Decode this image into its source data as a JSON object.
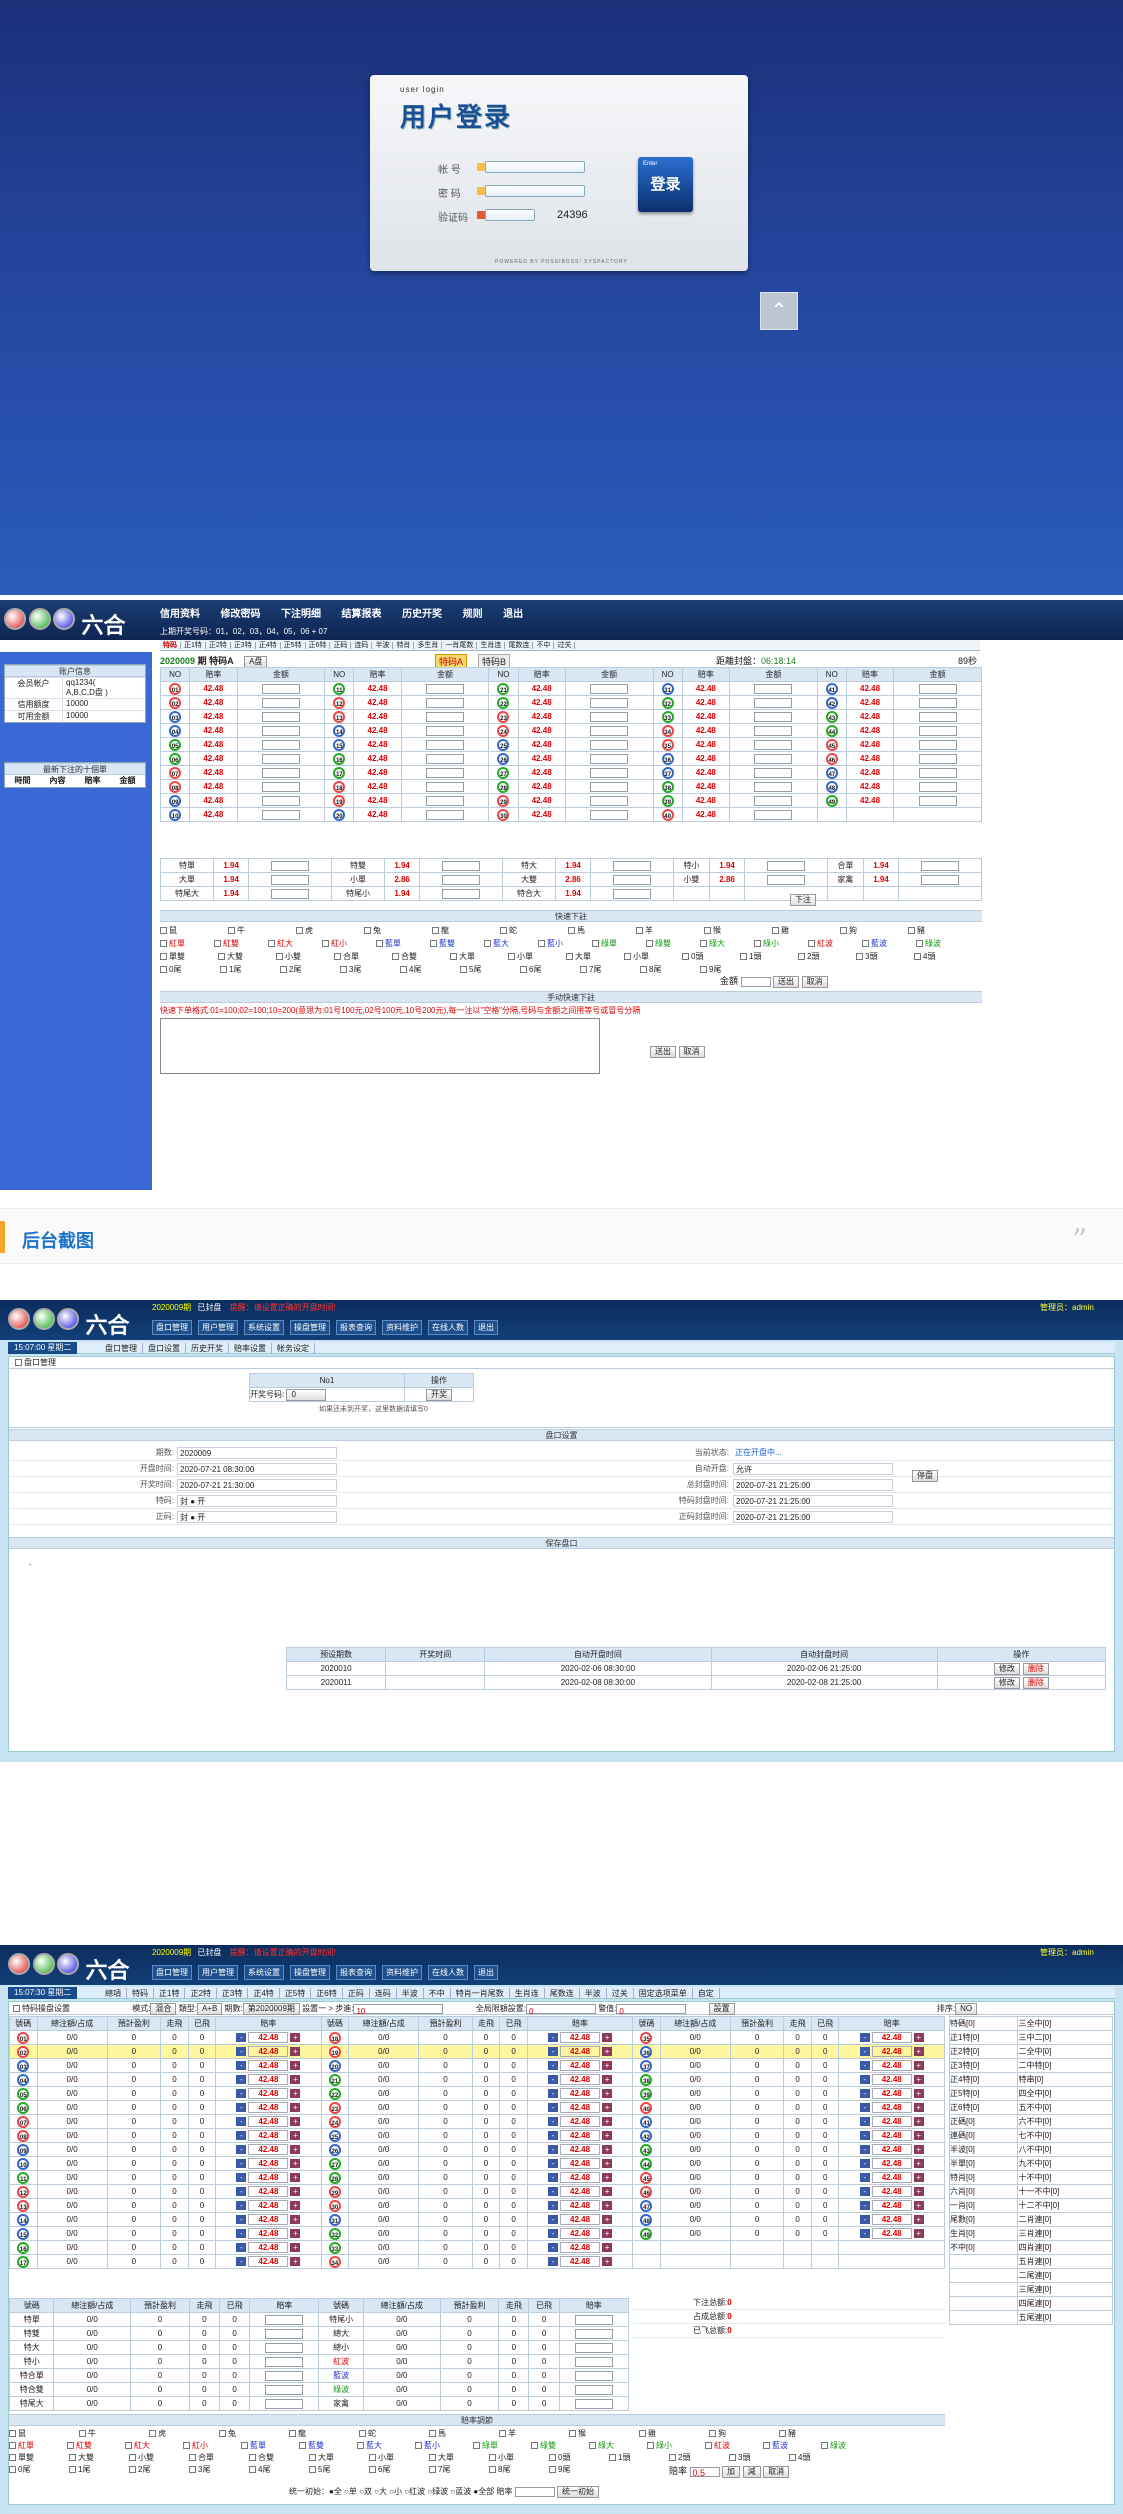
{
  "login": {
    "subtitle": "user login",
    "title": "用户登录",
    "fields": [
      {
        "label": "帐  号"
      },
      {
        "label": "密  码"
      },
      {
        "label": "验证码",
        "code": "24396"
      }
    ],
    "button_small": "Enter",
    "button_label": "登录",
    "powered": "POWERED BY POSSIBOSS! SYSPACTORY",
    "scroll_icon": "chevron-up-icon"
  },
  "member": {
    "nav": [
      "信用资料",
      "修改密码",
      "下注明细",
      "结算报表",
      "历史开奖",
      "规则",
      "退出"
    ],
    "draw_result_label": "上期开奖号码：",
    "draw_result": "01，02，03，04，05，06 + 07",
    "tabs": [
      "特码",
      "正1特",
      "正2特",
      "正3特",
      "正4特",
      "正5特",
      "正6特",
      "正码",
      "连码",
      "半波",
      "特肖",
      "多生肖",
      "一肖尾数",
      "生肖连",
      "尾数连",
      "不中",
      "过关"
    ],
    "account_title": "账户信息",
    "account_rows": [
      {
        "k": "会员帐户",
        "v": "qq1234(\nA,B,C,D盘 )"
      },
      {
        "k": "信用额度",
        "v": "10000"
      },
      {
        "k": "可用金额",
        "v": "10000"
      }
    ],
    "recent_title": "最新下注的十個單",
    "recent_cols": [
      "時間",
      "內容",
      "賠率",
      "金額"
    ],
    "issue": "2020009",
    "issue_label": "期 特码A",
    "pan": "A盘",
    "tab_a": "特码A",
    "tab_b": "特码B",
    "close_label": "距離封盤：",
    "close_time": "06:18:14",
    "countdown": "89秒",
    "col_no": "NO",
    "col_odds": "赔率",
    "col_amount": "金额",
    "odds": "42.48",
    "balls": [
      [
        "01",
        "02",
        "03",
        "04",
        "05",
        "06",
        "07",
        "08",
        "09",
        "10"
      ],
      [
        "11",
        "12",
        "13",
        "14",
        "15",
        "16",
        "17",
        "18",
        "19",
        "20"
      ],
      [
        "21",
        "22",
        "23",
        "24",
        "25",
        "26",
        "27",
        "28",
        "29",
        "30"
      ],
      [
        "31",
        "32",
        "33",
        "34",
        "35",
        "36",
        "37",
        "38",
        "39",
        "40"
      ],
      [
        "41",
        "42",
        "43",
        "44",
        "45",
        "46",
        "47",
        "48",
        "49"
      ]
    ],
    "bottom_rows": [
      [
        {
          "k": "特單",
          "v": "1.94"
        },
        {
          "k": "特雙",
          "v": "1.94"
        },
        {
          "k": "特大",
          "v": "1.94"
        },
        {
          "k": "特小",
          "v": "1.94"
        },
        {
          "k": "合單",
          "v": "1.94"
        }
      ],
      [
        {
          "k": "大單",
          "v": "1.94"
        },
        {
          "k": "小單",
          "v": "2.86"
        },
        {
          "k": "大雙",
          "v": "2.86"
        },
        {
          "k": "小雙",
          "v": "2.86"
        },
        {
          "k": "家禽",
          "v": "1.94"
        }
      ],
      [
        {
          "k": "特尾大",
          "v": "1.94"
        },
        {
          "k": "特尾小",
          "v": "1.94"
        },
        {
          "k": "特合大",
          "v": "1.94"
        }
      ]
    ],
    "next_btn": "下注",
    "quick_title": "快速下註",
    "quick_zodiac": [
      "鼠",
      "牛",
      "虎",
      "兔",
      "龍",
      "蛇",
      "馬",
      "羊",
      "猴",
      "雞",
      "狗",
      "豬"
    ],
    "quick_colors": [
      "紅單",
      "紅雙",
      "紅大",
      "紅小",
      "藍單",
      "藍雙",
      "藍大",
      "藍小",
      "綠單",
      "綠雙",
      "綠大",
      "綠小",
      "紅波",
      "藍波",
      "綠波"
    ],
    "quick_size": [
      "單雙",
      "大雙",
      "小雙",
      "合單",
      "合雙",
      "大單",
      "小單",
      "大單",
      "小單",
      "0頭",
      "1頭",
      "2頭",
      "3頭",
      "4頭"
    ],
    "quick_tail": [
      "0尾",
      "1尾",
      "2尾",
      "3尾",
      "4尾",
      "5尾",
      "6尾",
      "7尾",
      "8尾",
      "9尾"
    ],
    "quick_amount_label": "金額",
    "quick_submit": "送出",
    "quick_cancel": "取消",
    "manual_title": "手动快速下註",
    "manual_hint": "快速下单格式:01=100;02=100;10=200(意思为:01号100元,02号100元,10号200元),每一注以\"空格\"分隔,号码与金额之间用等号或冒号分隔",
    "manual_submit": "送出",
    "manual_cancel": "取消"
  },
  "section_heading": "后台截图",
  "quote_icon": "quote-icon",
  "admin1": {
    "issue_tag": "2020009期",
    "status": "已封盘",
    "notice": "提醒：请设置正确的开盘时间!",
    "admin_label": "管理员：admin",
    "menu": [
      "盘口管理",
      "用户管理",
      "系统设置",
      "操盘管理",
      "报表查询",
      "资料维护",
      "在线人数",
      "退出"
    ],
    "clock": "15:07:00 星期二",
    "tabs": [
      "盘口管理",
      "盘口设置",
      "历史开奖",
      "赔率设置",
      "帐务设定"
    ],
    "section_title": "盘口管理",
    "open_table_header": [
      "No1",
      "操作"
    ],
    "open_number_label": "开奖号码:",
    "open_number_value": "0",
    "open_btn": "开奖",
    "open_hint": "如果还未到开奖，这里数据请填写0",
    "settings_title": "盘口设置",
    "form_left": [
      {
        "k": "期数:",
        "v": "2020009"
      },
      {
        "k": "开盘时间:",
        "v": "2020-07-21 08:30:00"
      },
      {
        "k": "开奖时间:",
        "v": "2020-07-21 21:30:00"
      },
      {
        "k": "特码:",
        "v": "封  ● 开"
      },
      {
        "k": "正码:",
        "v": "封  ● 开"
      }
    ],
    "form_right": [
      {
        "k": "当前状态:",
        "v": "正在开盘中..."
      },
      {
        "k": "自动开盘:",
        "v": "允许"
      },
      {
        "k": "总封盘时间:",
        "v": "2020-07-21 21:25:00"
      },
      {
        "k": "特码封盘时间:",
        "v": "2020-07-21 21:25:00"
      },
      {
        "k": "正码封盘时间:",
        "v": "2020-07-21 21:25:00"
      }
    ],
    "stop_btn": "停盘",
    "save_btn": "保存盘口",
    "schedule_cols": [
      "预设期数",
      "开奖时间",
      "自动开盘时间",
      "自动封盘时间",
      "操作"
    ],
    "schedule_rows": [
      {
        "id": "2020010",
        "open": "2020-02-06 08:30:00",
        "close": "2020-02-06 21:25:00"
      },
      {
        "id": "2020011",
        "open": "2020-02-08 08:30:00",
        "close": "2020-02-08 21:25:00"
      }
    ],
    "edit_btn": "修改",
    "delete_btn": "删除"
  },
  "admin2": {
    "issue_tag": "2020009期",
    "status": "已封盘",
    "notice": "提醒：请设置正确的开盘时间!",
    "admin_label": "管理员：admin",
    "menu": [
      "盘口管理",
      "用户管理",
      "系统设置",
      "操盘管理",
      "报表查询",
      "资料维护",
      "在线人数",
      "退出"
    ],
    "clock": "15:07:30 星期二",
    "tabs": [
      "總項",
      "特码",
      "正1特",
      "正2特",
      "正3特",
      "正4特",
      "正5特",
      "正6特",
      "正码",
      "连码",
      "半波",
      "不中",
      "特肖一肖尾数",
      "生肖连",
      "尾数连",
      "半波",
      "过关",
      "固定选项菜单",
      "自定"
    ],
    "filter": {
      "title": "特码操盘设置",
      "mode_label": "模式:",
      "mode_value": "混合",
      "type_label": "類型:",
      "type_value": "A+B",
      "issue_label": "期數:",
      "issue_value": "第2020009期",
      "step_label": "設置一 > 步進:",
      "step_value": "10",
      "warn_label": "全局限額設置:",
      "warn_value": "0",
      "alert_label": "警值:",
      "alert_value": "0",
      "set_btn": "設置",
      "sort_label": "排序:",
      "sort_value": "NO"
    },
    "cols": [
      "號碼",
      "總注額/占成",
      "預計盈利",
      "走飛",
      "已飛",
      "賠率"
    ],
    "odds": "42.48",
    "balls": [
      [
        "01",
        "02",
        "03",
        "04",
        "05",
        "06",
        "07",
        "08",
        "09",
        "10",
        "11",
        "12",
        "13",
        "14",
        "15",
        "16",
        "17"
      ],
      [
        "18",
        "19",
        "20",
        "21",
        "22",
        "23",
        "24",
        "25",
        "26",
        "27",
        "28",
        "29",
        "30",
        "31",
        "32",
        "33",
        "34"
      ],
      [
        "35",
        "36",
        "37",
        "38",
        "39",
        "40",
        "41",
        "42",
        "43",
        "44",
        "45",
        "46",
        "47",
        "48",
        "49"
      ]
    ],
    "zero": "0/0",
    "side_labels": [
      "特碼",
      "正1特",
      "正2特",
      "正3特",
      "正4特",
      "正5特",
      "正6特",
      "正碼",
      "連碼",
      "半波",
      "半單",
      "特肖",
      "六肖",
      "一肖",
      "尾數",
      "生肖",
      "不中"
    ],
    "right_labels": [
      "三全中",
      "三中二",
      "二全中",
      "二中特",
      "特串",
      "四全中",
      "五不中",
      "六不中",
      "七不中",
      "八不中",
      "九不中",
      "十不中",
      "十一不中",
      "十二不中",
      "二肖連",
      "三肖連",
      "四肖連",
      "五肖連",
      "二尾連",
      "三尾連",
      "四尾連",
      "五尾連"
    ],
    "sum_labels": [
      "下注总额:",
      "占成总额:",
      "已飞总额:"
    ],
    "small_rows": [
      "特單",
      "特雙",
      "特大",
      "特小",
      "特合單",
      "特合雙",
      "特尾大",
      "特尾小",
      "總大",
      "總小",
      "紅波",
      "藍波",
      "綠波",
      "家禽"
    ],
    "quick_title": "賠率調節",
    "quick_amount_label": "賠率",
    "quick_amount": "0.5",
    "quick_add": "加",
    "quick_sub": "減",
    "quick_cancel": "取消",
    "bottom_text": "统一初始：●全 ○单 ○双 ○大 ○小 ○红波 ○绿波 ○蓝波 ●全部 賠率",
    "bottom_btn": "统一初始"
  }
}
